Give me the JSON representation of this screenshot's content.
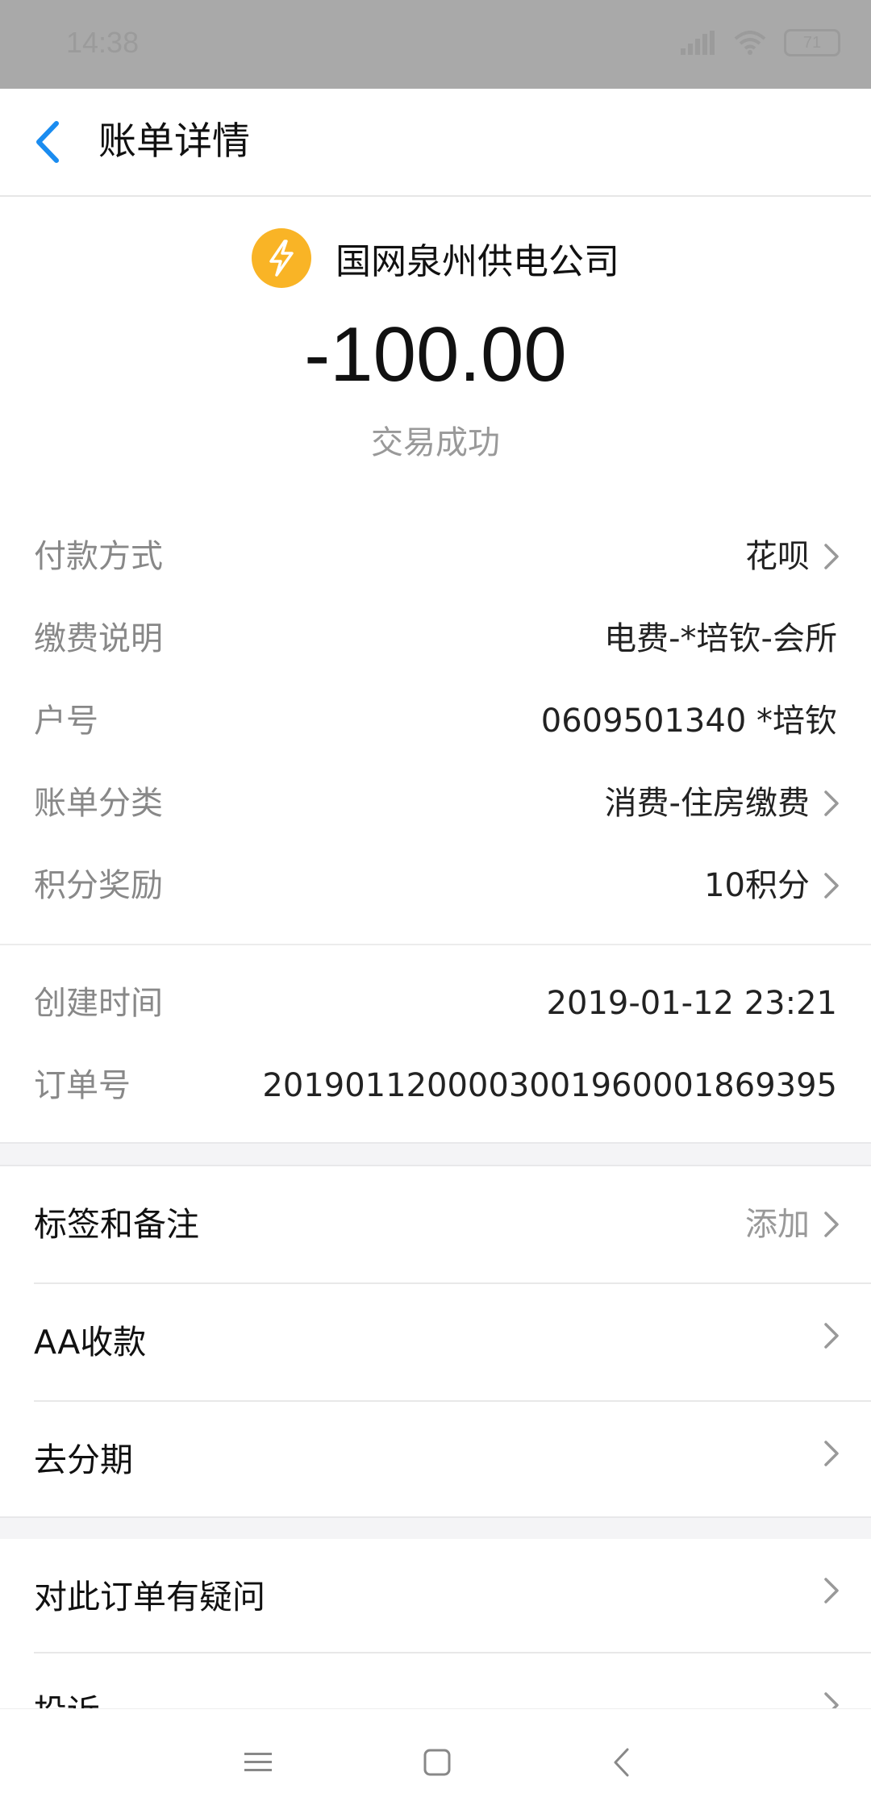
{
  "status_bar": {
    "time": "14:38",
    "battery": "71"
  },
  "header": {
    "title": "账单详情"
  },
  "merchant": {
    "name": "国网泉州供电公司",
    "icon": "lightning-icon",
    "logo_color": "#f9b426"
  },
  "amount": "-100.00",
  "status": "交易成功",
  "details": [
    {
      "label": "付款方式",
      "value": "花呗"
    },
    {
      "label": "缴费说明",
      "value": "电费-*培钦-会所"
    },
    {
      "label": "户号",
      "value": "0609501340 *培钦"
    },
    {
      "label": "账单分类",
      "value": "消费-住房缴费"
    },
    {
      "label": "积分奖励",
      "value": "10积分"
    }
  ],
  "details2": [
    {
      "label": "创建时间",
      "value": "2019-01-12 23:21"
    },
    {
      "label": "订单号",
      "value": "2019011200003001960001869395"
    }
  ],
  "menu": [
    {
      "label": "标签和备注",
      "right": "添加"
    },
    {
      "label": "AA收款",
      "right": ""
    },
    {
      "label": "去分期",
      "right": ""
    }
  ],
  "menu2": [
    {
      "label": "对此订单有疑问"
    },
    {
      "label": "投诉"
    }
  ],
  "colors": {
    "accent": "#1a8cf0",
    "status_bar": "#a9a9a9",
    "label_gray": "#888888"
  }
}
